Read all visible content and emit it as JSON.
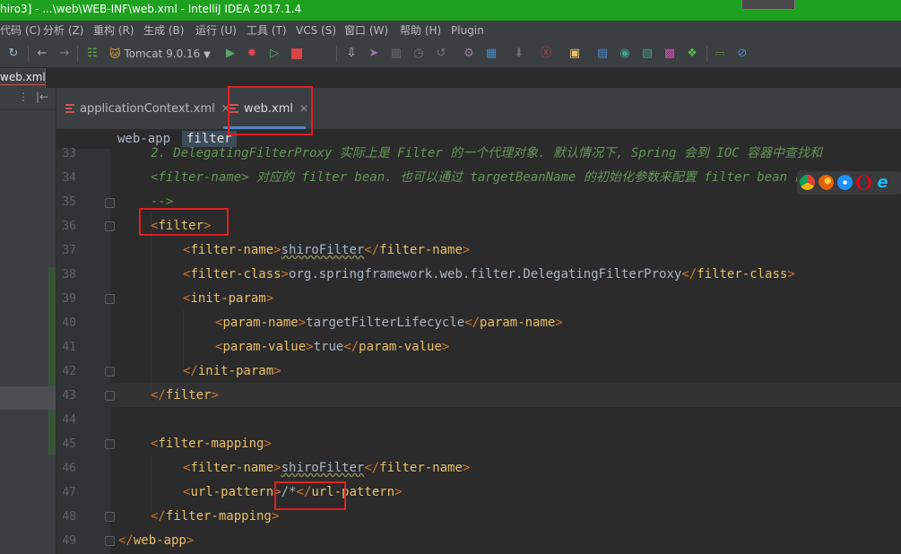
{
  "window": {
    "title": "hiro3] - ...\\web\\WEB-INF\\web.xml - IntelliJ IDEA 2017.1.4"
  },
  "menu": [
    "代码 (C)",
    "分析 (Z)",
    "重构 (R)",
    "生成 (B)",
    "运行 (U)",
    "工具 (T)",
    "VCS (S)",
    "窗口 (W)",
    "帮助 (H)",
    "Plugin"
  ],
  "toolbar": {
    "run_config": "Tomcat 9.0.16",
    "icons": [
      "search-icon",
      "back-arrow-icon",
      "forward-arrow-icon",
      "structure-icon",
      "tomcat-icon",
      "run-icon",
      "debug-icon",
      "coverage-icon",
      "stop-icon",
      "update-icon",
      "vcs-commit-icon",
      "compare-icon",
      "history-icon",
      "revert-icon",
      "settings-icon",
      "project-structure-icon",
      "file-icon",
      "help-icon",
      "plugin-icon",
      "database-icon",
      "terminal-icon",
      "puzzle-icon",
      "monitor-icon",
      "disable-icon"
    ]
  },
  "nav": {
    "breadcrumb_file": "web.xml"
  },
  "tabs": [
    {
      "label": "applicationContext.xml",
      "active": false
    },
    {
      "label": "web.xml",
      "active": true
    }
  ],
  "editor_breadcrumb": [
    "web-app",
    "filter"
  ],
  "editor": {
    "current_line": 43,
    "lines": [
      {
        "n": "33",
        "cmt": "2. DelegatingFilterProxy 实际上是 Filter 的一个代理对象. 默认情况下, Spring 会到 IOC 容器中查找和"
      },
      {
        "n": "34",
        "cmt": "<filter-name> 对应的 filter bean. 也可以通过 targetBeanName 的初始化参数来配置 filter bean 的 id."
      },
      {
        "n": "35",
        "cmt": "-->"
      },
      {
        "n": "36",
        "open": "filter"
      },
      {
        "n": "37",
        "open": "filter-name",
        "text": "shiroFilter",
        "close": "filter-name"
      },
      {
        "n": "38",
        "open": "filter-class",
        "text": "org.springframework.web.filter.DelegatingFilterProxy",
        "close": "filter-class"
      },
      {
        "n": "39",
        "open": "init-param"
      },
      {
        "n": "40",
        "open": "param-name",
        "text": "targetFilterLifecycle",
        "close": "param-name"
      },
      {
        "n": "41",
        "open": "param-value",
        "text": "true",
        "close": "param-value"
      },
      {
        "n": "42",
        "close": "init-param"
      },
      {
        "n": "43",
        "close": "filter"
      },
      {
        "n": "44"
      },
      {
        "n": "45",
        "open": "filter-mapping"
      },
      {
        "n": "46",
        "open": "filter-name",
        "text": "shiroFilter",
        "close": "filter-name"
      },
      {
        "n": "47",
        "open": "url-pattern",
        "text": "/*",
        "close": "url-pattern"
      },
      {
        "n": "48",
        "close": "filter-mapping"
      },
      {
        "n": "49",
        "close": "web-app"
      }
    ]
  },
  "browser_icons": [
    "chrome-icon",
    "firefox-icon",
    "safari-icon",
    "opera-icon",
    "ie-icon"
  ],
  "colors": {
    "titlebar": "#1ea11e",
    "tag": "#e8bf6a",
    "bracket": "#cc7832",
    "text": "#a9b7c6",
    "comment": "#629755",
    "highlight_box": "#e02020",
    "active_tab_underline": "#4a88c7"
  }
}
